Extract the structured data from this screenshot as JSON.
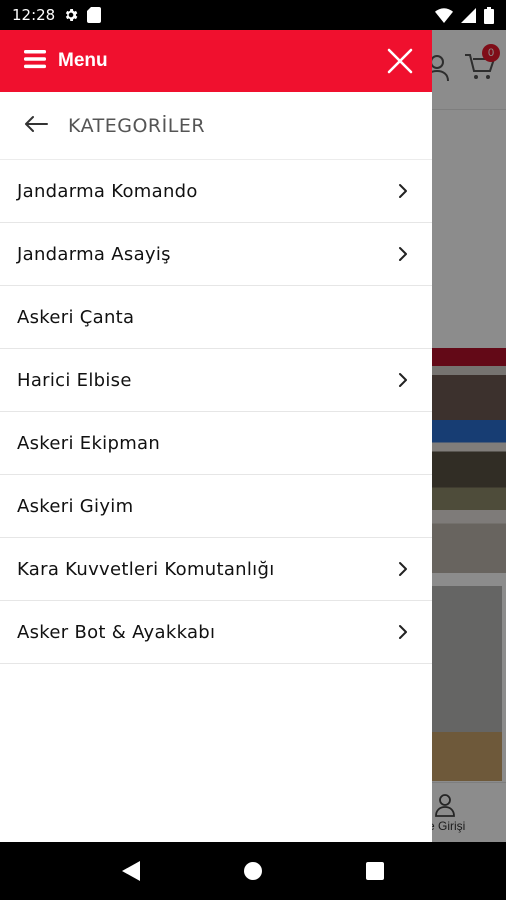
{
  "status_bar": {
    "time": "12:28",
    "icons": [
      "gear-icon",
      "sd-card-icon",
      "wifi-icon",
      "signal-icon",
      "battery-icon"
    ]
  },
  "drawer": {
    "title": "Menu",
    "section_title": "KATEGORİLER",
    "accent_color": "#f0102e",
    "categories": [
      {
        "label": "Jandarma Komando",
        "has_children": true
      },
      {
        "label": "Jandarma Asayiş",
        "has_children": true
      },
      {
        "label": "Askeri Çanta",
        "has_children": false
      },
      {
        "label": "Harici Elbise",
        "has_children": true
      },
      {
        "label": "Askeri Ekipman",
        "has_children": false
      },
      {
        "label": "Askeri Giyim",
        "has_children": false
      },
      {
        "label": "Kara Kuvvetleri Komutanlığı",
        "has_children": true
      },
      {
        "label": "Asker Bot & Ayakkabı",
        "has_children": true
      }
    ]
  },
  "background": {
    "cart_count": "0",
    "bottom_nav_label": "e Girişi"
  },
  "nav_bar": {
    "icons": [
      "back-icon",
      "home-icon",
      "recents-icon"
    ]
  }
}
